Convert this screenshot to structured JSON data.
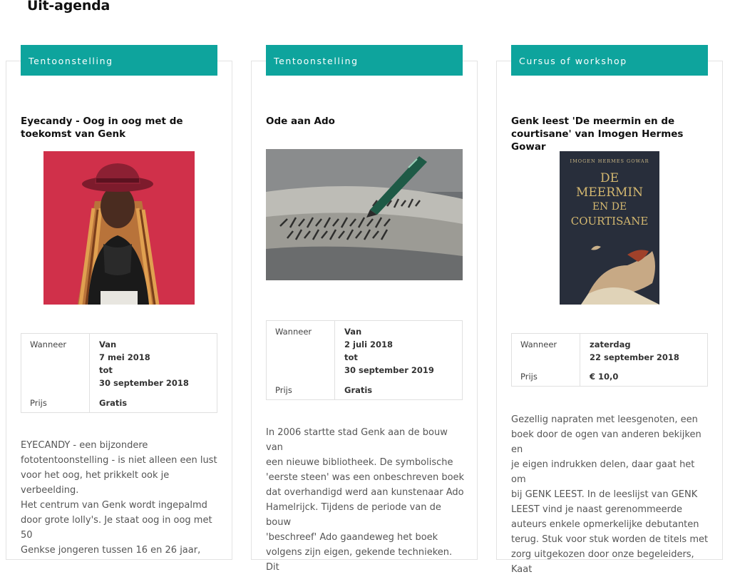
{
  "page": {
    "title": "Uit-agenda"
  },
  "accent_color": "#0ea49d",
  "cards": [
    {
      "category": "Tentoonstelling",
      "title_lines": [
        "Eyecandy - Oog in oog met de",
        "toekomst van Genk"
      ],
      "image": "portrait-woman-red-hat",
      "labels": {
        "when": "Wanneer",
        "price": "Prijs"
      },
      "when_lines": [
        "Van",
        "7 mei 2018",
        "tot",
        "30 september 2018"
      ],
      "price": "Gratis",
      "desc_lines": [
        "EYECANDY - een bijzondere",
        "fototentoonstelling - is niet alleen een lust",
        "voor het oog, het prikkelt ook je verbeelding.",
        "Het centrum van Genk wordt ingepalmd",
        "door grote lolly's. Je staat oog in oog met 50",
        "Genkse jongeren tussen 16 en 26 jaar,"
      ]
    },
    {
      "category": "Tentoonstelling",
      "title_lines": [
        "Ode aan Ado"
      ],
      "image": "ink-pen-on-paper",
      "labels": {
        "when": "Wanneer",
        "price": "Prijs"
      },
      "when_lines": [
        "Van",
        "2 juli 2018",
        "tot",
        "30 september 2019"
      ],
      "price": "Gratis",
      "desc_lines": [
        "In 2006 startte stad Genk aan de bouw van",
        "een nieuwe bibliotheek. De symbolische",
        "'eerste steen' was een onbeschreven boek",
        "dat overhandigd werd aan kunstenaar Ado",
        "Hamelrijck. Tijdens de periode van de bouw",
        "'beschreef' Ado gaandeweg het boek",
        "volgens zijn eigen, gekende technieken. Dit"
      ]
    },
    {
      "category": "Cursus of workshop",
      "title_lines": [
        "Genk leest 'De meermin en de",
        "courtisane' van Imogen Hermes Gowar"
      ],
      "image": "book-cover",
      "book": {
        "author": "IMOGEN HERMES GOWAR",
        "title_lines": [
          "DE",
          "MEERMIN",
          "EN DE",
          "COURTISANE"
        ]
      },
      "labels": {
        "when": "Wanneer",
        "price": "Prijs"
      },
      "when_lines": [
        "zaterdag",
        "22 september 2018"
      ],
      "price": "€ 10,0",
      "desc_lines": [
        "Gezellig napraten met leesgenoten, een",
        "boek door de ogen van anderen bekijken en",
        "je eigen indrukken delen, daar gaat het om",
        "bij GENK LEEST. In de leeslijst van GENK",
        "LEEST vind je naast gerenommeerde",
        "auteurs enkele opmerkelijke debutanten",
        "terug. Stuk voor stuk worden de titels met",
        "zorg uitgekozen door onze begeleiders, Kaat"
      ]
    }
  ]
}
